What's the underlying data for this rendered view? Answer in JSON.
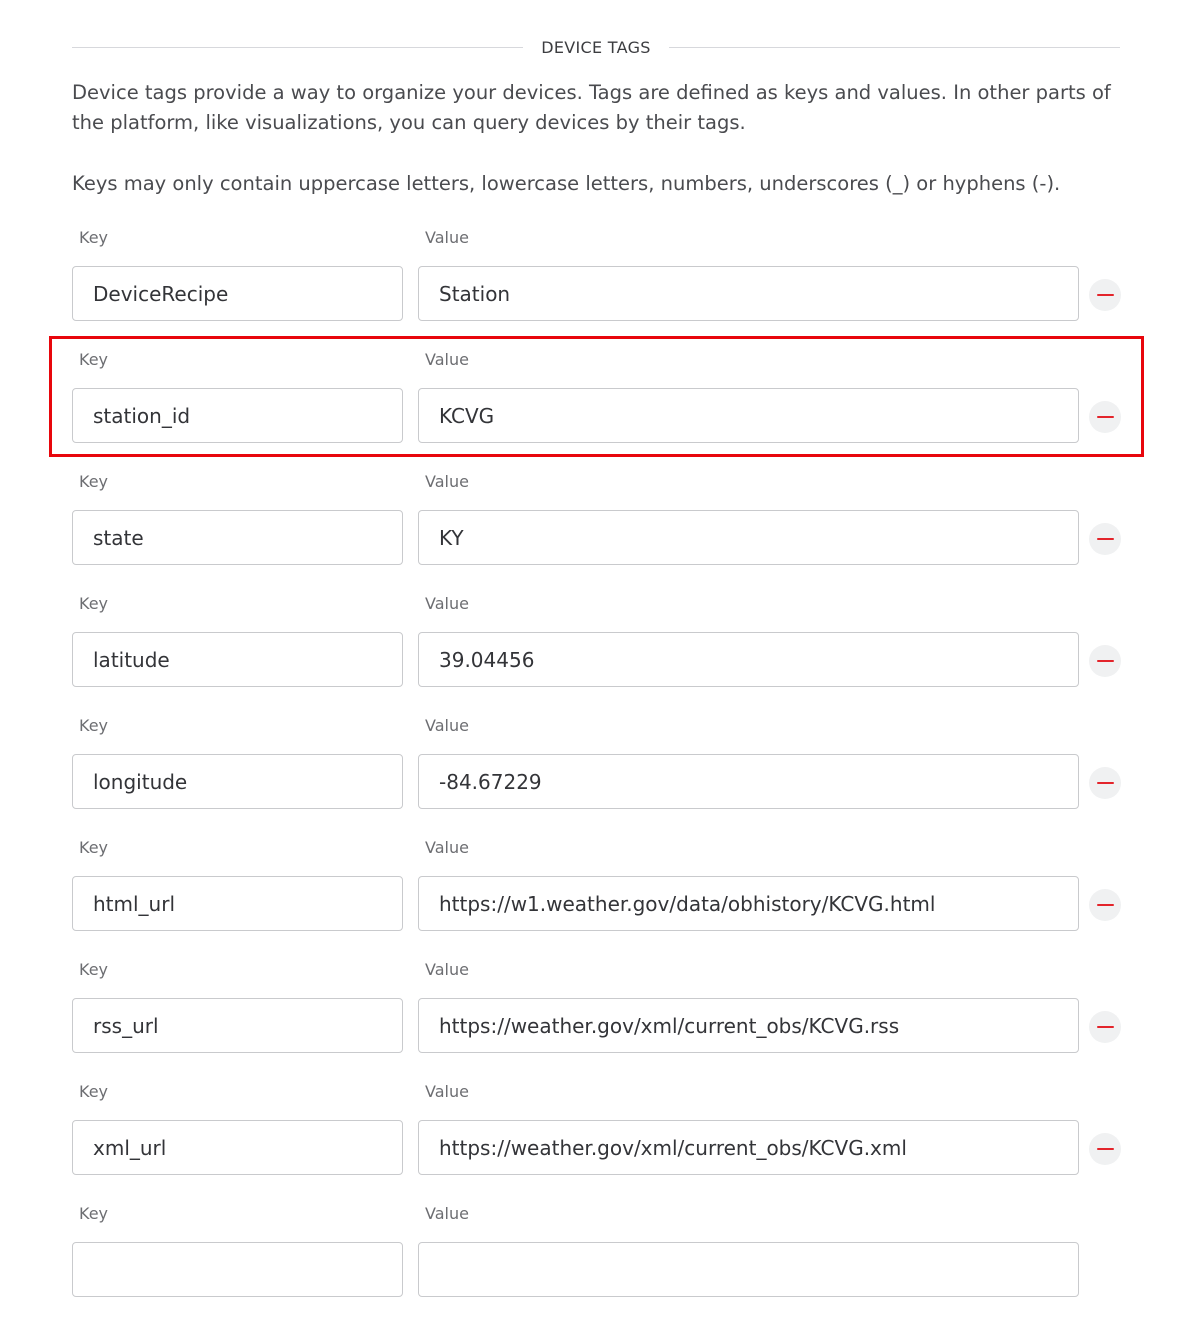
{
  "section": {
    "title": "DEVICE TAGS",
    "description": "Device tags provide a way to organize your devices. Tags are defined as keys and values. In other parts of the platform, like visualizations, you can query devices by their tags.",
    "key_rules": "Keys may only contain uppercase letters, lowercase letters, numbers, underscores (_) or hyphens (-)."
  },
  "labels": {
    "key": "Key",
    "value": "Value"
  },
  "colors": {
    "remove_icon": "#e3242b",
    "highlight_border": "#e8060c"
  },
  "tags": [
    {
      "key": "DeviceRecipe",
      "value": "Station"
    },
    {
      "key": "station_id",
      "value": "KCVG"
    },
    {
      "key": "state",
      "value": "KY"
    },
    {
      "key": "latitude",
      "value": "39.04456"
    },
    {
      "key": "longitude",
      "value": "-84.67229"
    },
    {
      "key": "html_url",
      "value": "https://w1.weather.gov/data/obhistory/KCVG.html"
    },
    {
      "key": "rss_url",
      "value": "https://weather.gov/xml/current_obs/KCVG.rss"
    },
    {
      "key": "xml_url",
      "value": "https://weather.gov/xml/current_obs/KCVG.xml"
    },
    {
      "key": "",
      "value": ""
    }
  ]
}
